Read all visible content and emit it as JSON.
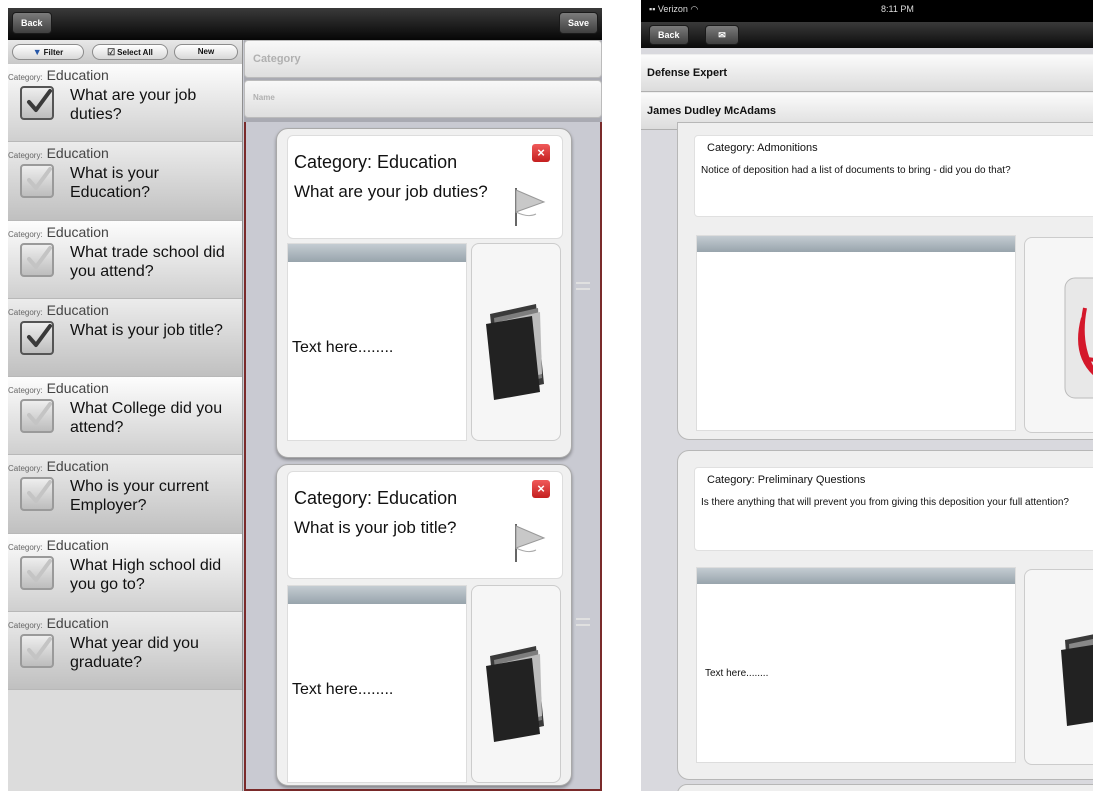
{
  "left_app": {
    "topbar": {
      "back_label": "Back",
      "save_label": "Save"
    },
    "list_toolbar": {
      "filter_label": "Filter",
      "select_all_label": "Select All",
      "new_label": "New"
    },
    "questions": [
      {
        "category_prefix": "Category:",
        "category": "Education",
        "text": "What are your job duties?",
        "checked": true
      },
      {
        "category_prefix": "Category:",
        "category": "Education",
        "text": "What is your Education?",
        "checked": false
      },
      {
        "category_prefix": "Category:",
        "category": "Education",
        "text": "What trade school did you attend?",
        "checked": false
      },
      {
        "category_prefix": "Category:",
        "category": "Education",
        "text": "What is your job title?",
        "checked": true
      },
      {
        "category_prefix": "Category:",
        "category": "Education",
        "text": "What College did you attend?",
        "checked": false
      },
      {
        "category_prefix": "Category:",
        "category": "Education",
        "text": "Who is your current Employer?",
        "checked": false
      },
      {
        "category_prefix": "Category:",
        "category": "Education",
        "text": "What High school did you go to?",
        "checked": false
      },
      {
        "category_prefix": "Category:",
        "category": "Education",
        "text": "What year did you graduate?",
        "checked": false
      }
    ],
    "form": {
      "category_placeholder": "Category",
      "name_placeholder": "Name",
      "cards": [
        {
          "category": "Category: Education",
          "question": "What are your job duties?",
          "text": "Text here........"
        },
        {
          "category": "Category: Education",
          "question": "What is your job title?",
          "text": "Text here........"
        }
      ]
    }
  },
  "right_app": {
    "status": {
      "carrier": "Verizon",
      "time": "8:11 PM"
    },
    "nav": {
      "back_label": "Back"
    },
    "header_rows": [
      "Defense Expert",
      "James Dudley McAdams"
    ],
    "cards": [
      {
        "category": "Category: Admonitions",
        "question": "Notice of deposition had a list of documents to bring - did you do that?",
        "text": ""
      },
      {
        "category": "Category: Preliminary Questions",
        "question": "Is there anything that will prevent you from giving this deposition your full attention?",
        "text": "Text here........"
      }
    ]
  }
}
